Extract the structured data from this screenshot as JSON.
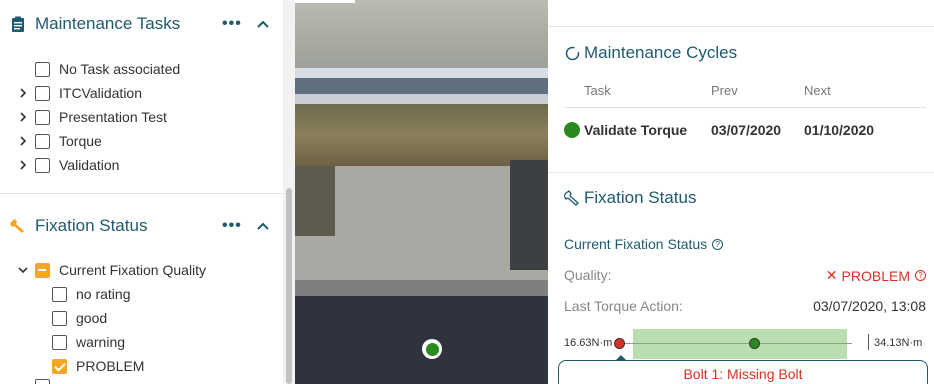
{
  "left_panel": {
    "maintenance_tasks": {
      "title": "Maintenance Tasks",
      "menu": "•••",
      "items": [
        {
          "label": "No Task associated",
          "expandable": false
        },
        {
          "label": "ITCValidation",
          "expandable": true
        },
        {
          "label": "Presentation Test",
          "expandable": true
        },
        {
          "label": "Torque",
          "expandable": true
        },
        {
          "label": "Validation",
          "expandable": true
        }
      ]
    },
    "fixation_status": {
      "title": "Fixation Status",
      "menu": "•••",
      "parent": {
        "label": "Current Fixation Quality",
        "state": "partial"
      },
      "items": [
        {
          "label": "no rating",
          "checked": false
        },
        {
          "label": "good",
          "checked": false
        },
        {
          "label": "warning",
          "checked": false
        },
        {
          "label": "PROBLEM",
          "checked": true
        }
      ]
    }
  },
  "map": {
    "marker_color": "#2a8a1f"
  },
  "right_panel": {
    "maintenance_cycles": {
      "title": "Maintenance Cycles",
      "columns": {
        "task": "Task",
        "prev": "Prev",
        "next": "Next"
      },
      "row": {
        "task": "Validate Torque",
        "prev": "03/07/2020",
        "next": "01/10/2020",
        "status_color": "#2a8a1f"
      }
    },
    "fixation_status": {
      "title": "Fixation Status",
      "subtitle": "Current Fixation Status",
      "quality_label": "Quality:",
      "quality_value": "PROBLEM",
      "quality_icon": "✕",
      "last_torque_label": "Last Torque Action:",
      "last_torque_value": "03/07/2020, 13:08",
      "gauge": {
        "min_label": "16.63N·m",
        "max_label": "34.13N·m"
      },
      "bolt_tooltip": "Bolt 1: Missing Bolt"
    }
  },
  "colors": {
    "accent": "#1f5a6e",
    "checkbox_orange": "#f5a623",
    "problem_red": "#d93025",
    "ok_green": "#2a8a1f"
  }
}
